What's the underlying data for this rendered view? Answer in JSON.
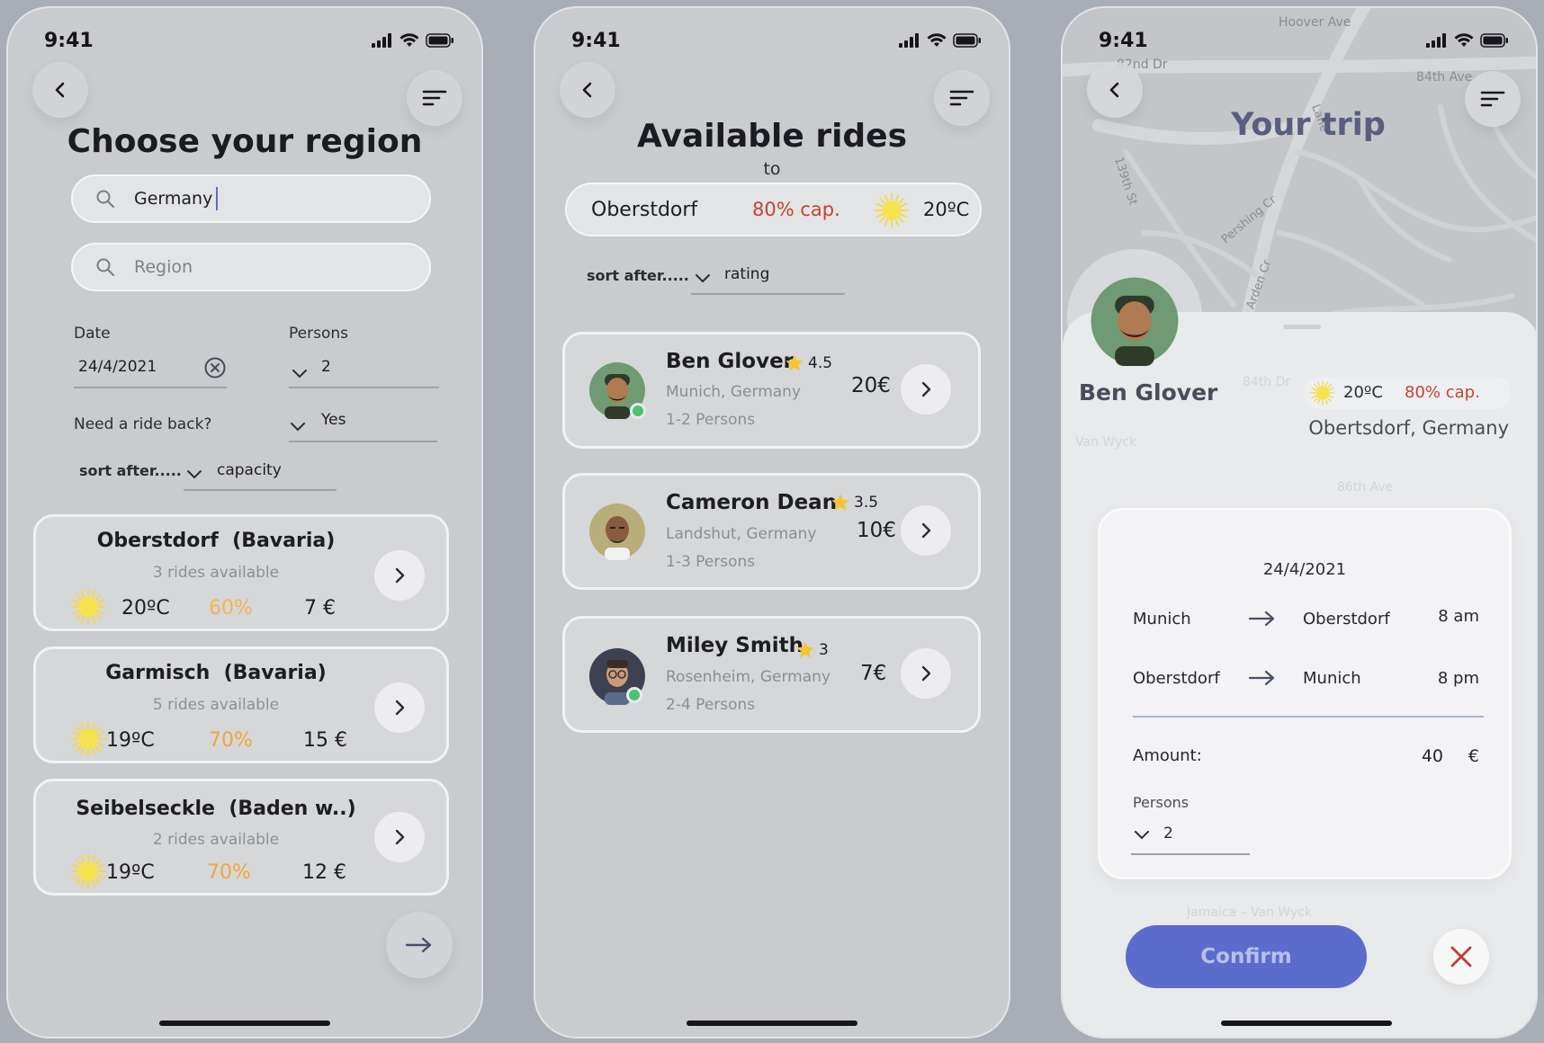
{
  "status_time": "9:41",
  "screen1": {
    "title": "Choose your region",
    "country_value": "Germany",
    "region_placeholder": "Region",
    "date_label": "Date",
    "date_value": "24/4/2021",
    "persons_label": "Persons",
    "persons_value": "2",
    "ride_back_label": "Need a ride back?",
    "ride_back_value": "Yes",
    "sort_label": "sort after.....",
    "sort_value": "capacity",
    "regions": [
      {
        "name": "Oberstdorf",
        "state": "(Bavaria)",
        "rides": "3 rides available",
        "temp": "20ºC",
        "capacity": "60%",
        "price": "7 €"
      },
      {
        "name": "Garmisch",
        "state": "(Bavaria)",
        "rides": "5 rides available",
        "temp": "19ºC",
        "capacity": "70%",
        "price": "15 €"
      },
      {
        "name": "Seibelseckle",
        "state": "(Baden w..)",
        "rides": "2 rides available",
        "temp": "19ºC",
        "capacity": "70%",
        "price": "12 €"
      }
    ]
  },
  "screen2": {
    "title": "Available rides",
    "to_label": "to",
    "destination": "Oberstdorf",
    "capacity": "80% cap.",
    "temp": "20ºC",
    "sort_label": "sort after.....",
    "sort_value": "rating",
    "rides": [
      {
        "name": "Ben Glover",
        "rating": "4.5",
        "location": "Munich, Germany",
        "persons": "1-2 Persons",
        "price": "20€"
      },
      {
        "name": "Cameron Dean",
        "rating": "3.5",
        "location": "Landshut, Germany",
        "persons": "1-3 Persons",
        "price": "10€"
      },
      {
        "name": "Miley Smith",
        "rating": "3",
        "location": "Rosenheim, Germany",
        "persons": "2-4 Persons",
        "price": "7€"
      }
    ]
  },
  "screen3": {
    "title": "Your trip",
    "driver": "Ben Glover",
    "temp": "20ºC",
    "capacity": "80% cap.",
    "destination": "Obertsdorf, Germany",
    "date": "24/4/2021",
    "legs": [
      {
        "from": "Munich",
        "to": "Oberstdorf",
        "time": "8 am"
      },
      {
        "from": "Oberstdorf",
        "to": "Munich",
        "time": "8 pm"
      }
    ],
    "amount_label": "Amount:",
    "amount_value": "40",
    "currency": "€",
    "persons_label": "Persons",
    "persons_value": "2",
    "confirm_label": "Confirm",
    "map_streets": [
      "Hoover Ave",
      "82nd Dr",
      "84th Ave",
      "139th St",
      "Pershing Cr",
      "Lane",
      "Arden Cr",
      "84th Dr",
      "86th Ave",
      "Van Wyck",
      "Jamaica – Van Wyck"
    ]
  },
  "colors": {
    "accent": "#5c6ccc",
    "orange": "#f0a73a",
    "red": "#c2452e",
    "online": "#4cc16e"
  }
}
